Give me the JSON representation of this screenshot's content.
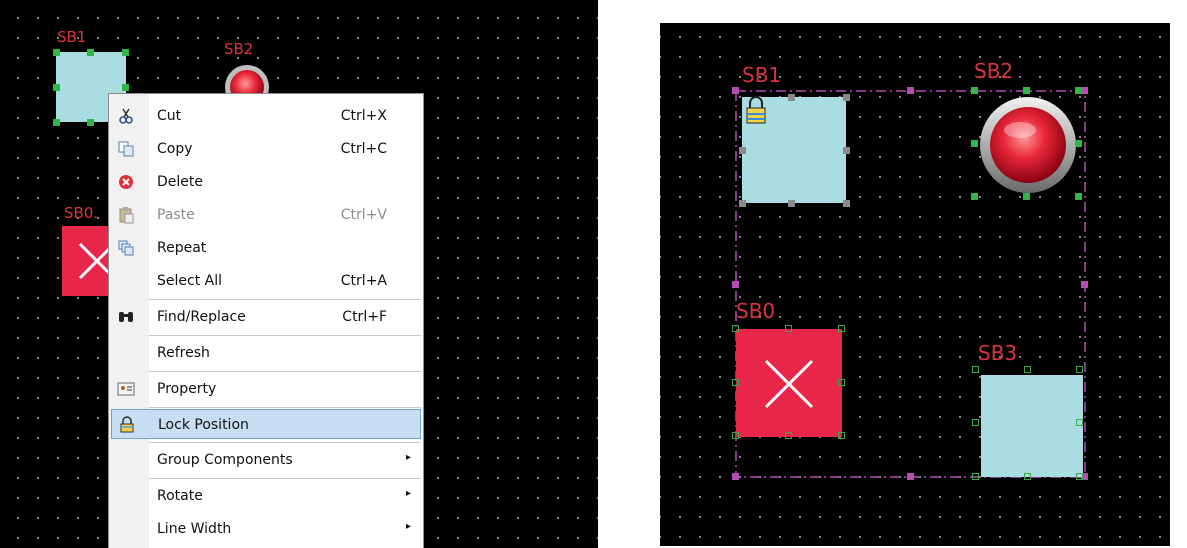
{
  "left_panel": {
    "labels": {
      "sb1": "SB1",
      "sb2": "SB2",
      "sb0": "SB0."
    }
  },
  "context_menu": {
    "items": [
      {
        "label": "Cut",
        "shortcut": "Ctrl+X",
        "icon": "scissors-icon",
        "enabled": true
      },
      {
        "label": "Copy",
        "shortcut": "Ctrl+C",
        "icon": "copy-icon",
        "enabled": true
      },
      {
        "label": "Delete",
        "shortcut": "",
        "icon": "delete-icon",
        "enabled": true
      },
      {
        "label": "Paste",
        "shortcut": "Ctrl+V",
        "icon": "paste-icon",
        "enabled": false
      },
      {
        "label": "Repeat",
        "shortcut": "",
        "icon": "repeat-icon",
        "enabled": true
      },
      {
        "label": "Select All",
        "shortcut": "Ctrl+A",
        "icon": "",
        "enabled": true
      },
      {
        "label": "Find/Replace",
        "shortcut": "Ctrl+F",
        "icon": "binoculars-icon",
        "enabled": true
      },
      {
        "label": "Refresh",
        "shortcut": "",
        "icon": "",
        "enabled": true
      },
      {
        "label": "Property",
        "shortcut": "",
        "icon": "property-icon",
        "enabled": true
      },
      {
        "label": "Lock Position",
        "shortcut": "",
        "icon": "lock-icon",
        "enabled": true,
        "highlighted": true
      },
      {
        "label": "Group Components",
        "shortcut": "",
        "icon": "",
        "enabled": true,
        "submenu": true
      },
      {
        "label": "Rotate",
        "shortcut": "",
        "icon": "",
        "enabled": true,
        "submenu": true
      },
      {
        "label": "Line Width",
        "shortcut": "",
        "icon": "",
        "enabled": true,
        "submenu": true
      }
    ],
    "submenu_arrow": "▸"
  },
  "right_panel": {
    "labels": {
      "sb1": "SB1",
      "sb2": "SB2",
      "sb0": "SB0",
      "sb3": "SB3"
    }
  },
  "colors": {
    "canvas_bg": "#000000",
    "label_red": "#d9333f",
    "button_lightblue": "#aadde1",
    "button_red": "#e8264a",
    "selection_green": "#2fb84a",
    "group_purple": "#b34fb3",
    "menu_highlight": "#c7def3"
  }
}
